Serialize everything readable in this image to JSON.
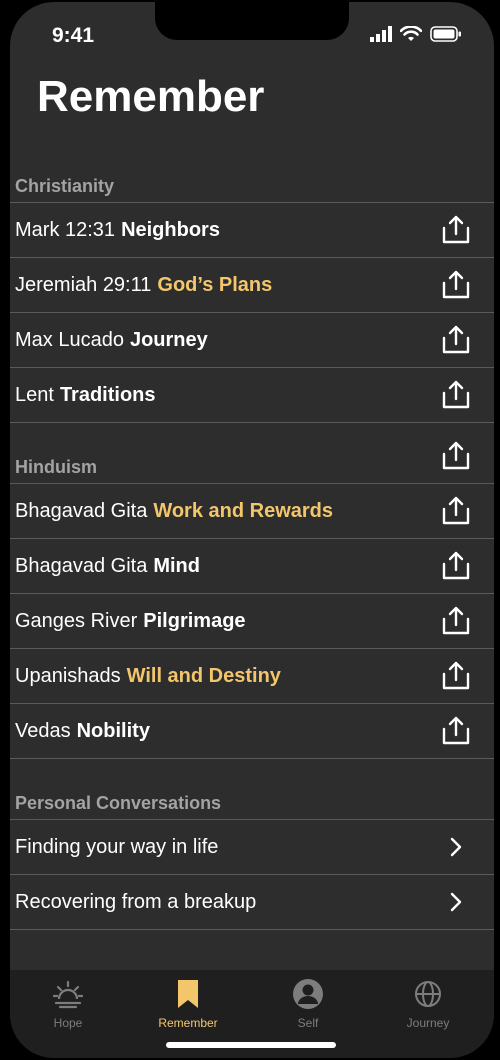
{
  "status": {
    "time": "9:41"
  },
  "page": {
    "title": "Remember"
  },
  "sections": [
    {
      "header": "Christianity",
      "items": [
        {
          "pre": "Mark 12:31",
          "highlight": "Neighbors",
          "highlight_color": "white",
          "action": "share-icon"
        },
        {
          "pre": "Jeremiah 29:11",
          "highlight": "God’s Plans",
          "highlight_color": "#f3c66b",
          "action": "share-icon"
        },
        {
          "pre": "Max Lucado",
          "highlight": "Journey",
          "highlight_color": "white",
          "action": "share-icon"
        },
        {
          "pre": "Lent",
          "highlight": "Traditions",
          "highlight_color": "white",
          "action": "share-icon"
        }
      ]
    },
    {
      "header": "Hinduism",
      "items": [
        {
          "pre": "Bhagavad Gita",
          "highlight": "Work and Rewards",
          "highlight_color": "#f3c66b",
          "action": "share-icon"
        },
        {
          "pre": "Bhagavad Gita",
          "highlight": "Mind",
          "highlight_color": "white",
          "action": "share-icon"
        },
        {
          "pre": "Ganges River",
          "highlight": "Pilgrimage",
          "highlight_color": "white",
          "action": "share-icon"
        },
        {
          "pre": "Upanishads",
          "highlight": "Will and Destiny",
          "highlight_color": "#f3c66b",
          "action": "share-icon"
        },
        {
          "pre": "Vedas",
          "highlight": "Nobility",
          "highlight_color": "white",
          "action": "share-icon"
        }
      ]
    },
    {
      "header": "Personal Conversations",
      "items": [
        {
          "pre": "Finding your way in life",
          "action": "chevron-right-icon"
        },
        {
          "pre": "Recovering from a breakup",
          "action": "chevron-right-icon"
        }
      ]
    }
  ],
  "tabbar": {
    "tabs": [
      {
        "label": "Hope",
        "icon": "sun-icon",
        "active": false
      },
      {
        "label": "Remember",
        "icon": "bookmark-icon",
        "active": true
      },
      {
        "label": "Self",
        "icon": "person-icon",
        "active": false
      },
      {
        "label": "Journey",
        "icon": "globe-icon",
        "active": false
      }
    ]
  },
  "colors": {
    "accent": "#f3c66b",
    "background": "#2d2d2d",
    "tabbar": "#1f1f1f"
  }
}
